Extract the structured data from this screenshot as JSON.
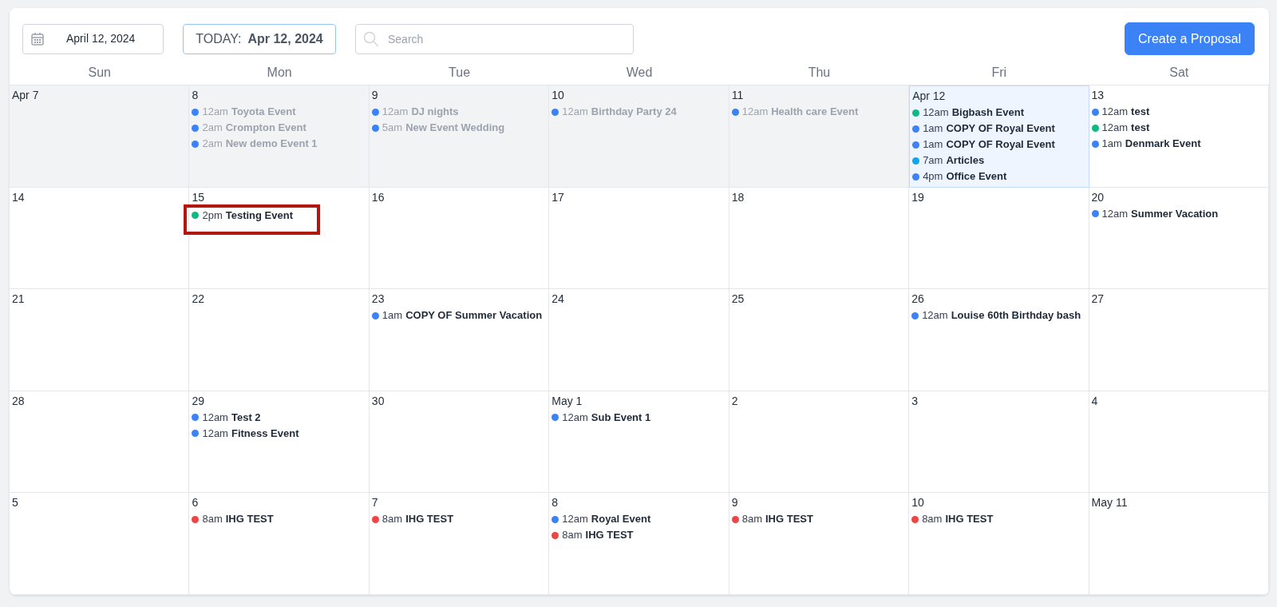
{
  "toolbar": {
    "date_picker": "April 12, 2024",
    "today_label": "TODAY:",
    "today_date": "Apr 12, 2024",
    "search": {
      "placeholder": "Search"
    },
    "create_button": "Create a Proposal"
  },
  "weekdays": [
    "Sun",
    "Mon",
    "Tue",
    "Wed",
    "Thu",
    "Fri",
    "Sat"
  ],
  "weeks": [
    {
      "days": [
        {
          "label": "Apr 7",
          "past": true,
          "today": false
        },
        {
          "label": "8",
          "past": true,
          "today": false,
          "events": [
            {
              "time": "12am",
              "title": "Toyota Event",
              "color": "#3b82f6",
              "highlighted": false
            },
            {
              "time": "2am",
              "title": "Crompton Event",
              "color": "#3b82f6",
              "highlighted": false
            },
            {
              "time": "2am",
              "title": "New demo Event 1",
              "color": "#3b82f6",
              "highlighted": false
            }
          ]
        },
        {
          "label": "9",
          "past": true,
          "today": false,
          "events": [
            {
              "time": "12am",
              "title": "DJ nights",
              "color": "#3b82f6",
              "highlighted": false
            },
            {
              "time": "5am",
              "title": "New Event Wedding",
              "color": "#3b82f6",
              "highlighted": false
            }
          ]
        },
        {
          "label": "10",
          "past": true,
          "today": false,
          "events": [
            {
              "time": "12am",
              "title": "Birthday Party 24",
              "color": "#3b82f6",
              "highlighted": false
            }
          ]
        },
        {
          "label": "11",
          "past": true,
          "today": false,
          "events": [
            {
              "time": "12am",
              "title": "Health care Event",
              "color": "#3b82f6",
              "highlighted": false
            }
          ]
        },
        {
          "label": "Apr 12",
          "past": false,
          "today": true,
          "events": [
            {
              "time": "12am",
              "title": "Bigbash Event",
              "color": "#10b981",
              "highlighted": false
            },
            {
              "time": "1am",
              "title": "COPY OF Royal Event",
              "color": "#3b82f6",
              "highlighted": false
            },
            {
              "time": "1am",
              "title": "COPY OF Royal Event",
              "color": "#3b82f6",
              "highlighted": false
            },
            {
              "time": "7am",
              "title": "Articles",
              "color": "#0ea5e9",
              "highlighted": false
            },
            {
              "time": "4pm",
              "title": "Office Event",
              "color": "#3b82f6",
              "highlighted": false
            }
          ]
        },
        {
          "label": "13",
          "past": false,
          "today": false,
          "events": [
            {
              "time": "12am",
              "title": "test",
              "color": "#3b82f6",
              "highlighted": false
            },
            {
              "time": "12am",
              "title": "test",
              "color": "#10b981",
              "highlighted": false
            },
            {
              "time": "1am",
              "title": "Denmark Event",
              "color": "#3b82f6",
              "highlighted": false
            }
          ]
        }
      ]
    },
    {
      "days": [
        {
          "label": "14",
          "past": false,
          "today": false
        },
        {
          "label": "15",
          "past": false,
          "today": false,
          "events": [
            {
              "time": "2pm",
              "title": "Testing Event",
              "color": "#10b981",
              "highlighted": true
            }
          ]
        },
        {
          "label": "16",
          "past": false,
          "today": false
        },
        {
          "label": "17",
          "past": false,
          "today": false
        },
        {
          "label": "18",
          "past": false,
          "today": false
        },
        {
          "label": "19",
          "past": false,
          "today": false
        },
        {
          "label": "20",
          "past": false,
          "today": false,
          "events": [
            {
              "time": "12am",
              "title": "Summer Vacation",
              "color": "#3b82f6",
              "highlighted": false
            }
          ]
        }
      ]
    },
    {
      "days": [
        {
          "label": "21",
          "past": false,
          "today": false
        },
        {
          "label": "22",
          "past": false,
          "today": false
        },
        {
          "label": "23",
          "past": false,
          "today": false,
          "events": [
            {
              "time": "1am",
              "title": "COPY OF Summer Vacation",
              "color": "#3b82f6",
              "highlighted": false
            }
          ]
        },
        {
          "label": "24",
          "past": false,
          "today": false
        },
        {
          "label": "25",
          "past": false,
          "today": false
        },
        {
          "label": "26",
          "past": false,
          "today": false,
          "events": [
            {
              "time": "12am",
              "title": "Louise 60th Birthday bash",
              "color": "#3b82f6",
              "highlighted": false
            }
          ]
        },
        {
          "label": "27",
          "past": false,
          "today": false
        }
      ]
    },
    {
      "days": [
        {
          "label": "28",
          "past": false,
          "today": false
        },
        {
          "label": "29",
          "past": false,
          "today": false,
          "events": [
            {
              "time": "12am",
              "title": "Test 2",
              "color": "#3b82f6",
              "highlighted": false
            },
            {
              "time": "12am",
              "title": "Fitness Event",
              "color": "#3b82f6",
              "highlighted": false
            }
          ]
        },
        {
          "label": "30",
          "past": false,
          "today": false
        },
        {
          "label": "May 1",
          "past": false,
          "today": false,
          "events": [
            {
              "time": "12am",
              "title": "Sub Event 1",
              "color": "#3b82f6",
              "highlighted": false
            }
          ]
        },
        {
          "label": "2",
          "past": false,
          "today": false
        },
        {
          "label": "3",
          "past": false,
          "today": false
        },
        {
          "label": "4",
          "past": false,
          "today": false
        }
      ]
    },
    {
      "days": [
        {
          "label": "5",
          "past": false,
          "today": false
        },
        {
          "label": "6",
          "past": false,
          "today": false,
          "events": [
            {
              "time": "8am",
              "title": "IHG TEST",
              "color": "#ef4444",
              "highlighted": false
            }
          ]
        },
        {
          "label": "7",
          "past": false,
          "today": false,
          "events": [
            {
              "time": "8am",
              "title": "IHG TEST",
              "color": "#ef4444",
              "highlighted": false
            }
          ]
        },
        {
          "label": "8",
          "past": false,
          "today": false,
          "events": [
            {
              "time": "12am",
              "title": "Royal Event",
              "color": "#3b82f6",
              "highlighted": false
            },
            {
              "time": "8am",
              "title": "IHG TEST",
              "color": "#ef4444",
              "highlighted": false
            }
          ]
        },
        {
          "label": "9",
          "past": false,
          "today": false,
          "events": [
            {
              "time": "8am",
              "title": "IHG TEST",
              "color": "#ef4444",
              "highlighted": false
            }
          ]
        },
        {
          "label": "10",
          "past": false,
          "today": false,
          "events": [
            {
              "time": "8am",
              "title": "IHG TEST",
              "color": "#ef4444",
              "highlighted": false
            }
          ]
        },
        {
          "label": "May 11",
          "past": false,
          "today": false
        }
      ]
    }
  ]
}
